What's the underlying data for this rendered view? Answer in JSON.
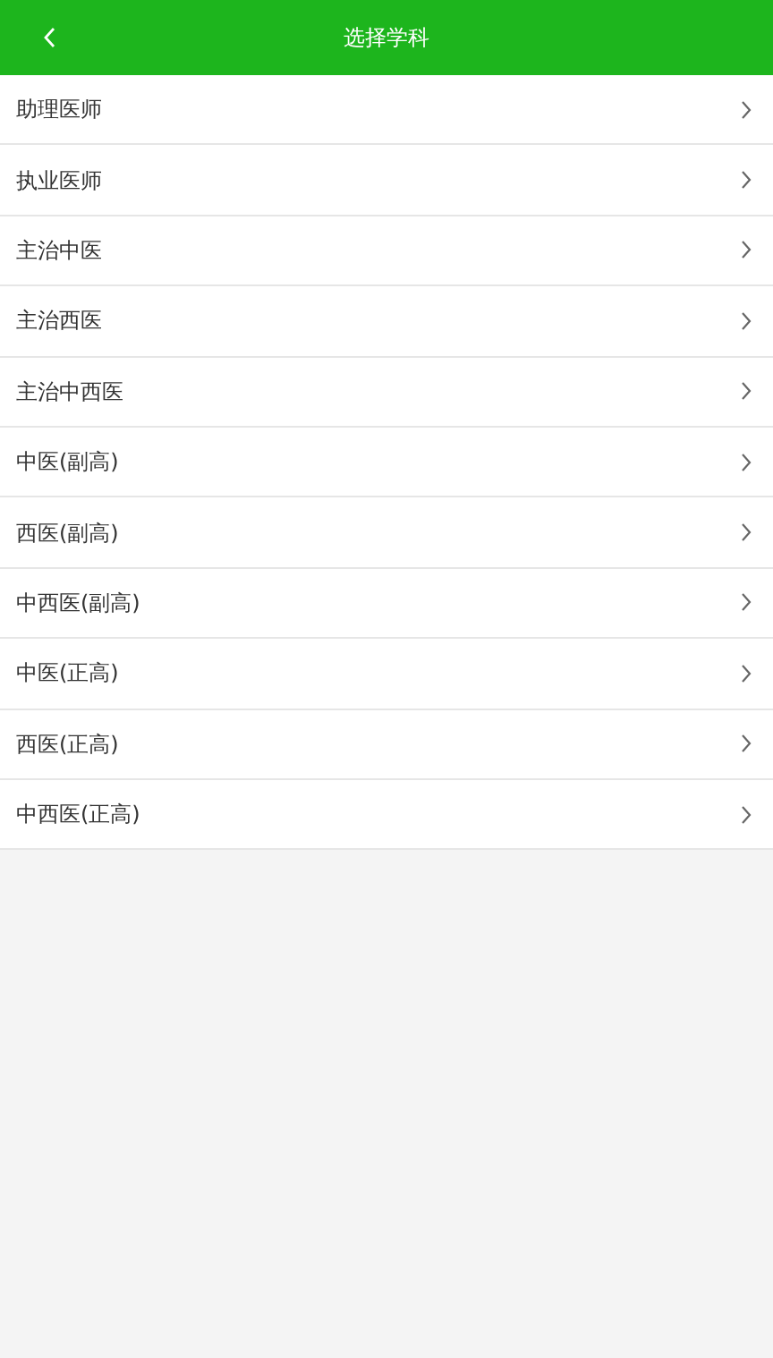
{
  "header": {
    "title": "选择学科"
  },
  "items": [
    {
      "label": "助理医师"
    },
    {
      "label": "执业医师"
    },
    {
      "label": "主治中医"
    },
    {
      "label": "主治西医"
    },
    {
      "label": "主治中西医"
    },
    {
      "label": "中医(副高)"
    },
    {
      "label": "西医(副高)"
    },
    {
      "label": "中西医(副高)"
    },
    {
      "label": "中医(正高)"
    },
    {
      "label": "西医(正高)"
    },
    {
      "label": "中西医(正高)"
    }
  ]
}
